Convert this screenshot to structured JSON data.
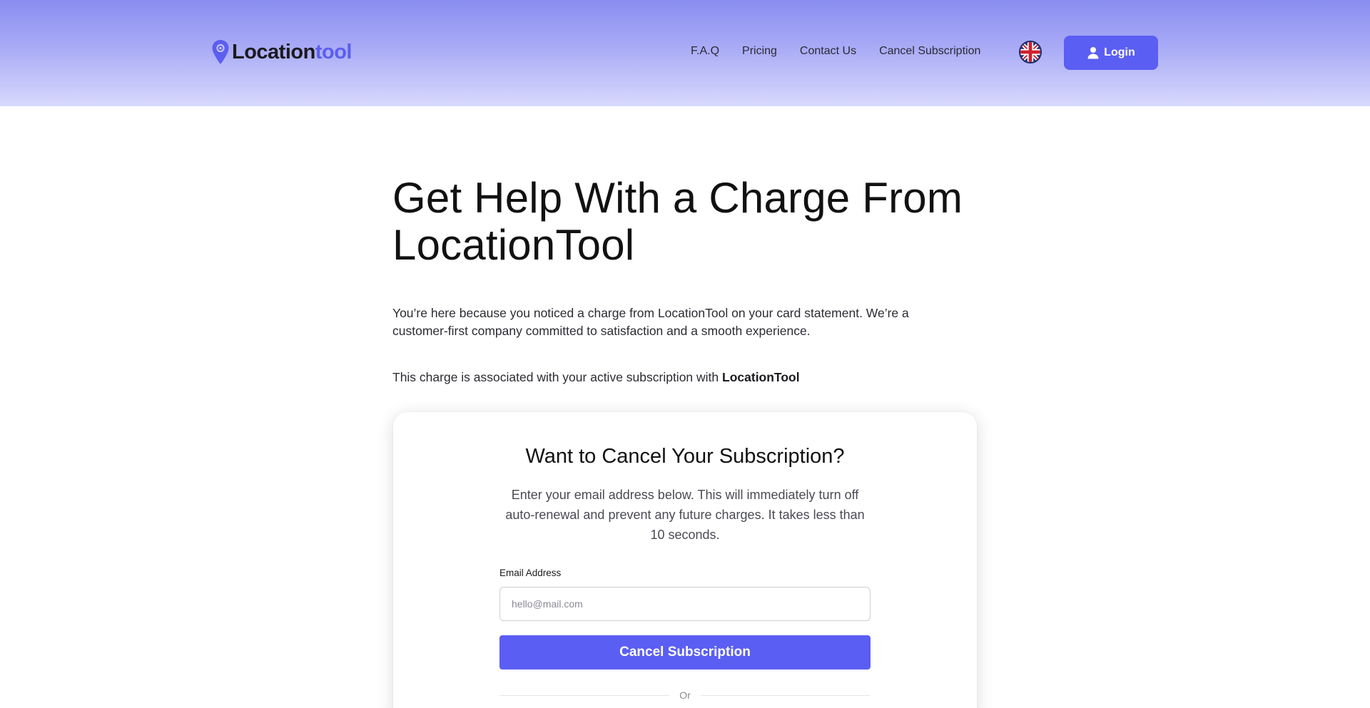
{
  "brand": {
    "name_main": "Location",
    "name_accent": "tool",
    "accent_color": "#5b5ef0"
  },
  "nav": {
    "items": [
      {
        "label": "F.A.Q"
      },
      {
        "label": "Pricing"
      },
      {
        "label": "Contact Us"
      },
      {
        "label": "Cancel Subscription"
      }
    ],
    "language_icon": "uk-flag-icon",
    "login_label": "Login",
    "login_icon": "user-icon"
  },
  "main": {
    "title": "Get Help With a Charge From LocationTool",
    "intro": "You’re here because you noticed a charge from LocationTool on your card statement. We’re a customer-first company committed to satisfaction and a smooth experience.",
    "assoc_prefix": "This charge is associated with your active subscription with ",
    "assoc_brand": "LocationTool"
  },
  "cancel_card": {
    "title": "Want to Cancel Your Subscription?",
    "description": "Enter your email address below. This will immediately turn off auto-renewal and prevent any future charges. It takes less than 10 seconds.",
    "email_label": "Email Address",
    "email_placeholder": "hello@mail.com",
    "email_value": "",
    "submit_label": "Cancel Subscription",
    "divider_text": "Or"
  },
  "colors": {
    "primary_button": "#5b5ef3",
    "header_gradient_top": "#8a8df0",
    "header_gradient_bottom": "#d8d9fd"
  }
}
